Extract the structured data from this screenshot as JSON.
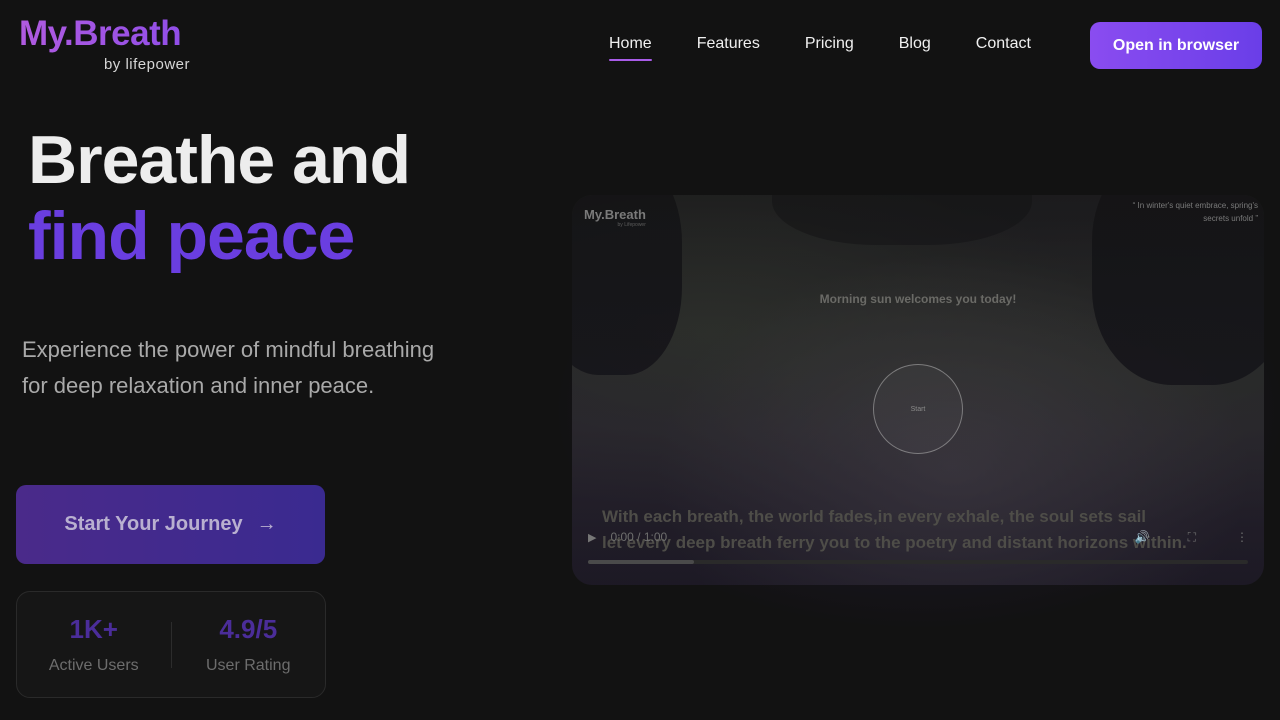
{
  "brand": {
    "title": "My.Breath",
    "subtitle": "by lifepower"
  },
  "nav": {
    "items": [
      {
        "label": "Home",
        "active": true
      },
      {
        "label": "Features",
        "active": false
      },
      {
        "label": "Pricing",
        "active": false
      },
      {
        "label": "Blog",
        "active": false
      },
      {
        "label": "Contact",
        "active": false
      }
    ],
    "cta_label": "Open in browser"
  },
  "hero": {
    "title_line1": "Breathe and",
    "title_line2": "find peace",
    "description": "Experience the power of mindful breathing for deep relaxation and inner peace.",
    "cta_label": "Start Your Journey",
    "cta_icon": "arrow-right-icon"
  },
  "stats": [
    {
      "value": "1K+",
      "label": "Active Users"
    },
    {
      "value": "4.9/5",
      "label": "User Rating"
    }
  ],
  "video": {
    "logo_title": "My.Breath",
    "logo_subtitle": "by Lifepower",
    "quote": "In winter's quiet embrace, spring's secrets unfold",
    "welcome_text": "Morning sun welcomes you today!",
    "start_label": "Start",
    "caption_line1": "With each breath, the world fades,in every exhale, the soul sets sail",
    "caption_line2": "let every deep breath ferry you to the poetry and distant horizons within.",
    "time": "0:00 / 1:00",
    "progress": 0.16
  },
  "colors": {
    "background": "#121212",
    "accent_purple": "#6a3ee0",
    "logo_gradient_start": "#b05be0",
    "button_gradient_start": "#8a4cf0"
  }
}
